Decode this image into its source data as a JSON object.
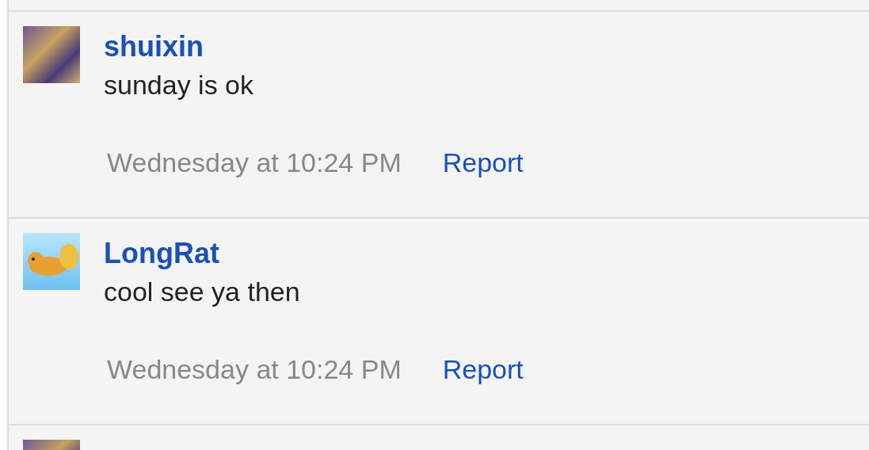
{
  "comments": [
    {
      "kind": "artwork",
      "name": "shuixin",
      "message": "sunday is ok",
      "time": "Wednesday at 10:24 PM",
      "action": "Report"
    },
    {
      "kind": "creature",
      "name": "LongRat",
      "message": "cool see ya then",
      "time": "Wednesday at 10:24 PM",
      "action": "Report"
    },
    {
      "kind": "artwork"
    }
  ]
}
